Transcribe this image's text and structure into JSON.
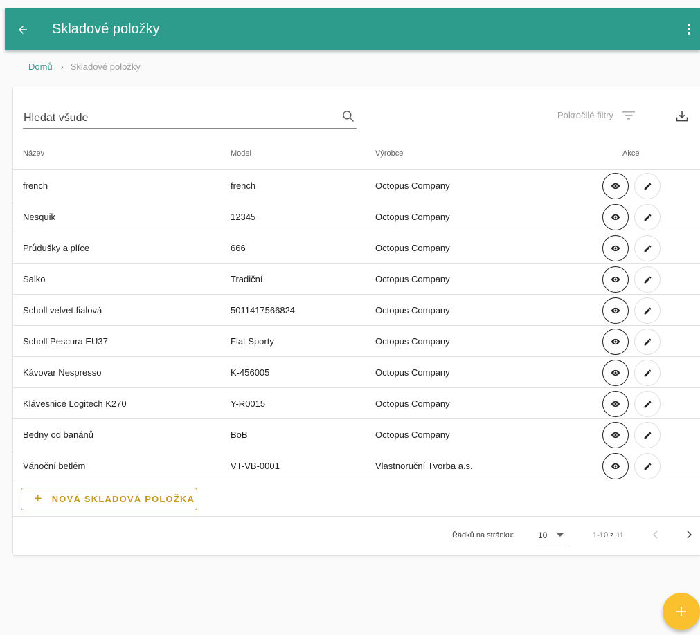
{
  "appbar": {
    "title": "Skladové položky"
  },
  "breadcrumb": {
    "home": "Domů",
    "separator": "›",
    "current": "Skladové položky"
  },
  "toolbar": {
    "search_placeholder": "Hledat všude",
    "advanced_filters": "Pokročilé filtry"
  },
  "table": {
    "headers": {
      "name": "Název",
      "model": "Model",
      "manufacturer": "Výrobce",
      "actions": "Akce"
    },
    "rows": [
      {
        "name": "french",
        "model": "french",
        "manufacturer": "Octopus Company"
      },
      {
        "name": "Nesquik",
        "model": "12345",
        "manufacturer": "Octopus Company"
      },
      {
        "name": "Průdušky a plíce",
        "model": "666",
        "manufacturer": "Octopus Company"
      },
      {
        "name": "Salko",
        "model": "Tradiční",
        "manufacturer": "Octopus Company"
      },
      {
        "name": "Scholl velvet fialová",
        "model": "5011417566824",
        "manufacturer": "Octopus Company"
      },
      {
        "name": "Scholl Pescura EU37",
        "model": "Flat Sporty",
        "manufacturer": "Octopus Company"
      },
      {
        "name": "Kávovar Nespresso",
        "model": "K-456005",
        "manufacturer": "Octopus Company"
      },
      {
        "name": "Klávesnice Logitech K270",
        "model": "Y-R0015",
        "manufacturer": "Octopus Company"
      },
      {
        "name": "Bedny od banánů",
        "model": "BoB",
        "manufacturer": "Octopus Company"
      },
      {
        "name": "Vánoční betlém",
        "model": "VT-VB-0001",
        "manufacturer": "Vlastnoruční Tvorba a.s."
      }
    ]
  },
  "new_item_button": "NOVÁ SKLADOVÁ POLOŽKA",
  "pagination": {
    "rows_per_page_label": "Řádků na stránku:",
    "rows_per_page_value": "10",
    "range": "1-10 z 11"
  },
  "colors": {
    "primary": "#2e9c8c",
    "accent": "#fbc02d",
    "button_text": "#c39a1c"
  },
  "icons": [
    "arrow-left-icon",
    "more-vert-icon",
    "search-icon",
    "filter-icon",
    "download-icon",
    "eye-icon",
    "pencil-icon",
    "plus-icon",
    "chevron-left-icon",
    "chevron-right-icon"
  ]
}
